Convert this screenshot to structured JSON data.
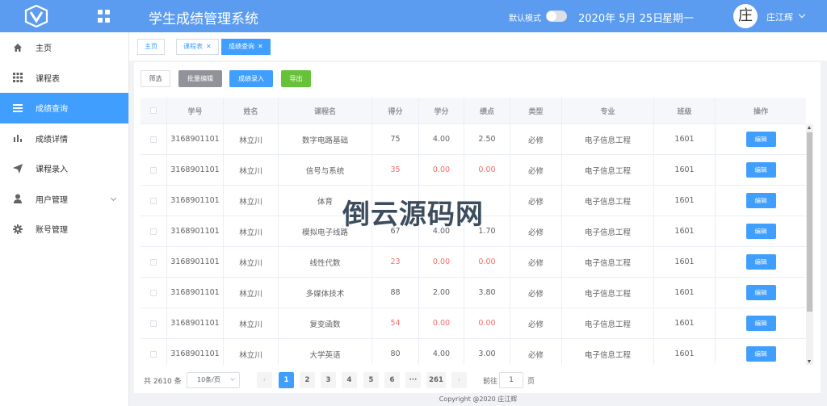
{
  "header": {
    "title": "学生成绩管理系统",
    "dark_mode_label": "默认模式",
    "date": "2020年 5月 25日",
    "weekday": "星期一",
    "avatar_char": "庄",
    "username": "庄江辉",
    "bg_color": "#5b9cf0"
  },
  "sidebar": {
    "items": [
      {
        "label": "主页",
        "icon": "home-icon"
      },
      {
        "label": "课程表",
        "icon": "grid-icon"
      },
      {
        "label": "成绩查询",
        "icon": "list-icon",
        "active": true
      },
      {
        "label": "成绩详情",
        "icon": "bar-chart-icon"
      },
      {
        "label": "课程录入",
        "icon": "send-icon"
      },
      {
        "label": "用户管理",
        "icon": "user-icon",
        "expandable": true
      },
      {
        "label": "账号管理",
        "icon": "gear-icon"
      }
    ]
  },
  "tabs": [
    {
      "label": "主页",
      "closable": false
    },
    {
      "label": "课程表",
      "closable": true
    },
    {
      "label": "成绩查询",
      "closable": true,
      "active": true
    }
  ],
  "toolbar": {
    "filter": "筛选",
    "batch_edit": "批量编辑",
    "grade_entry": "成绩录入",
    "export": "导出"
  },
  "table": {
    "columns": [
      "学号",
      "姓名",
      "课程名",
      "得分",
      "学分",
      "绩点",
      "类型",
      "专业",
      "班级",
      "操作"
    ],
    "edit_label": "编辑",
    "rows": [
      {
        "id": "3168901101",
        "name": "林立川",
        "course": "数字电路基础",
        "score": "75",
        "credit": "4.00",
        "gpa": "2.50",
        "type": "必修",
        "major": "电子信息工程",
        "class": "1601",
        "fail": false
      },
      {
        "id": "3168901101",
        "name": "林立川",
        "course": "信号与系统",
        "score": "35",
        "credit": "0.00",
        "gpa": "0.00",
        "type": "必修",
        "major": "电子信息工程",
        "class": "1601",
        "fail": true
      },
      {
        "id": "3168901101",
        "name": "林立川",
        "course": "体育",
        "score": "",
        "credit": "",
        "gpa": "",
        "type": "必修",
        "major": "电子信息工程",
        "class": "1601",
        "fail": false
      },
      {
        "id": "3168901101",
        "name": "林立川",
        "course": "模拟电子线路",
        "score": "67",
        "credit": "4.00",
        "gpa": "1.70",
        "type": "必修",
        "major": "电子信息工程",
        "class": "1601",
        "fail": false
      },
      {
        "id": "3168901101",
        "name": "林立川",
        "course": "线性代数",
        "score": "23",
        "credit": "0.00",
        "gpa": "0.00",
        "type": "必修",
        "major": "电子信息工程",
        "class": "1601",
        "fail": true
      },
      {
        "id": "3168901101",
        "name": "林立川",
        "course": "多媒体技术",
        "score": "88",
        "credit": "2.00",
        "gpa": "3.80",
        "type": "必修",
        "major": "电子信息工程",
        "class": "1601",
        "fail": false
      },
      {
        "id": "3168901101",
        "name": "林立川",
        "course": "复变函数",
        "score": "54",
        "credit": "0.00",
        "gpa": "0.00",
        "type": "必修",
        "major": "电子信息工程",
        "class": "1601",
        "fail": true
      },
      {
        "id": "3168901101",
        "name": "林立川",
        "course": "大学英语",
        "score": "80",
        "credit": "4.00",
        "gpa": "3.00",
        "type": "必修",
        "major": "电子信息工程",
        "class": "1601",
        "fail": false
      }
    ]
  },
  "pagination": {
    "total": "共 2610 条",
    "page_size": "10条/页",
    "prev": "‹",
    "next": "›",
    "pages": [
      "1",
      "2",
      "3",
      "4",
      "5",
      "6",
      "···",
      "261"
    ],
    "current": "1",
    "goto_label": "前往",
    "goto_value": "1",
    "goto_suffix": "页"
  },
  "footer": "Copyright @2020 庄江辉",
  "watermark": "倒云源码网"
}
